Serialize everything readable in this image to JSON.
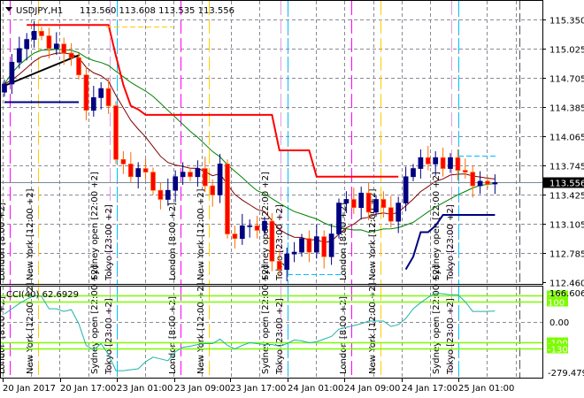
{
  "header": {
    "symbol": "USDJPY,H1",
    "ohlc": "113.560 113.608 113.535 113.556"
  },
  "cci_header": {
    "label": "CCI(40) 62.6929"
  },
  "chart_data": [
    {
      "type": "candlestick",
      "title": "USDJPY,H1",
      "ylim": [
        112.46,
        115.35
      ],
      "y_ticks": [
        "115.350",
        "115.025",
        "114.705",
        "114.385",
        "114.065",
        "113.745",
        "113.425",
        "113.105",
        "112.785",
        "112.460"
      ],
      "current_price": "113.556",
      "first_open": 114.55,
      "closes": [
        114.64,
        114.88,
        115.03,
        115.13,
        115.22,
        115.17,
        115.03,
        115.08,
        114.98,
        114.93,
        114.74,
        114.35,
        114.49,
        114.59,
        114.4,
        113.81,
        113.76,
        113.62,
        113.71,
        113.67,
        113.47,
        113.37,
        113.47,
        113.62,
        113.67,
        113.62,
        113.71,
        113.52,
        113.42,
        113.76,
        112.99,
        112.94,
        113.08,
        113.08,
        113.03,
        113.13,
        112.69,
        112.6,
        112.77,
        112.79,
        112.94,
        112.79,
        112.96,
        112.74,
        112.99,
        113.33,
        113.37,
        113.28,
        113.44,
        113.23,
        113.37,
        113.28,
        113.13,
        113.33,
        113.62,
        113.71,
        113.83,
        113.76,
        113.83,
        113.71,
        113.83,
        113.69,
        113.67,
        113.52,
        113.57,
        113.54,
        113.556
      ],
      "resistance_line": {
        "start_index": 3,
        "values": [
          115.29,
          115.29,
          115.29,
          115.29,
          115.29,
          115.29,
          115.29,
          115.29,
          115.29,
          115.29,
          115.29,
          115.29,
          114.95,
          114.63,
          114.4,
          114.36,
          114.3,
          114.3,
          114.3,
          114.3,
          114.3,
          114.3,
          114.3,
          114.3,
          114.3,
          114.3,
          114.3,
          114.3,
          114.3,
          114.3,
          114.3,
          114.3,
          114.3,
          114.3,
          113.91,
          113.91,
          113.91,
          113.91,
          113.91,
          113.62,
          113.62,
          113.62,
          113.62,
          113.62,
          113.62,
          113.62,
          113.62,
          113.62,
          113.62,
          113.62,
          113.62
        ]
      },
      "support_line_1": {
        "start_index": 0,
        "values": [
          114.44,
          114.44,
          114.44,
          114.44,
          114.44,
          114.44,
          114.44,
          114.44,
          114.44,
          114.44,
          114.44
        ]
      },
      "support_line_2": {
        "start_index": 54,
        "values": [
          112.6,
          112.74,
          113.01,
          113.01,
          113.08,
          113.2,
          113.2,
          113.2,
          113.2,
          113.2,
          113.2,
          113.2,
          113.2
        ]
      },
      "x_labels": [
        "20 Jan 2017",
        "20 Jan 17:00",
        "23 Jan 01:00",
        "23 Jan 09:00",
        "23 Jan 17:00",
        "24 Jan 01:00",
        "24 Jan 09:00",
        "24 Jan 17:00",
        "25 Jan 01:00"
      ]
    },
    {
      "type": "line",
      "title": "CCI(40)",
      "ylim": [
        -279.4792,
        166.606
      ],
      "y_labels": {
        "max": "166.606",
        "zero": "0.00",
        "min": "-279.4792"
      },
      "levels": [
        "130",
        "100",
        "-100",
        "-130"
      ],
      "values": [
        45,
        75,
        105,
        130,
        150,
        145,
        75,
        75,
        60,
        70,
        -10,
        -130,
        -155,
        -120,
        -180,
        -270,
        -270,
        -265,
        -260,
        -220,
        -195,
        -205,
        -215,
        -165,
        -140,
        -135,
        -125,
        -120,
        -120,
        -95,
        -130,
        -150,
        -130,
        -115,
        -120,
        -125,
        -125,
        -135,
        -120,
        -100,
        -105,
        -115,
        -110,
        -95,
        -80,
        -40,
        -30,
        -20,
        -10,
        5,
        5,
        5,
        -25,
        -15,
        20,
        75,
        110,
        140,
        165,
        160,
        155,
        155,
        115,
        60,
        60,
        60,
        62.69
      ]
    }
  ],
  "sessions": {
    "london": "London  [8:00  +2]",
    "newyork": "New York  [12:00  +2]",
    "sydney": "Sydney open  [22:00  +2]",
    "tokyo": "Tokyo  [23:00  +2]"
  },
  "colors": {
    "bull": "#000080",
    "bear": "#ff0000",
    "bear_border": "#ff6a00",
    "resistance": "#ff0000",
    "support": "#000080",
    "ma_slow": "#008000",
    "ma_fast": "#800000",
    "cci": "#20b2aa",
    "level": "#7cfc00",
    "london": "#ff00ff",
    "newyork": "#ffcc00",
    "sydney": "#dda0dd",
    "tokyo": "#00bfff"
  }
}
